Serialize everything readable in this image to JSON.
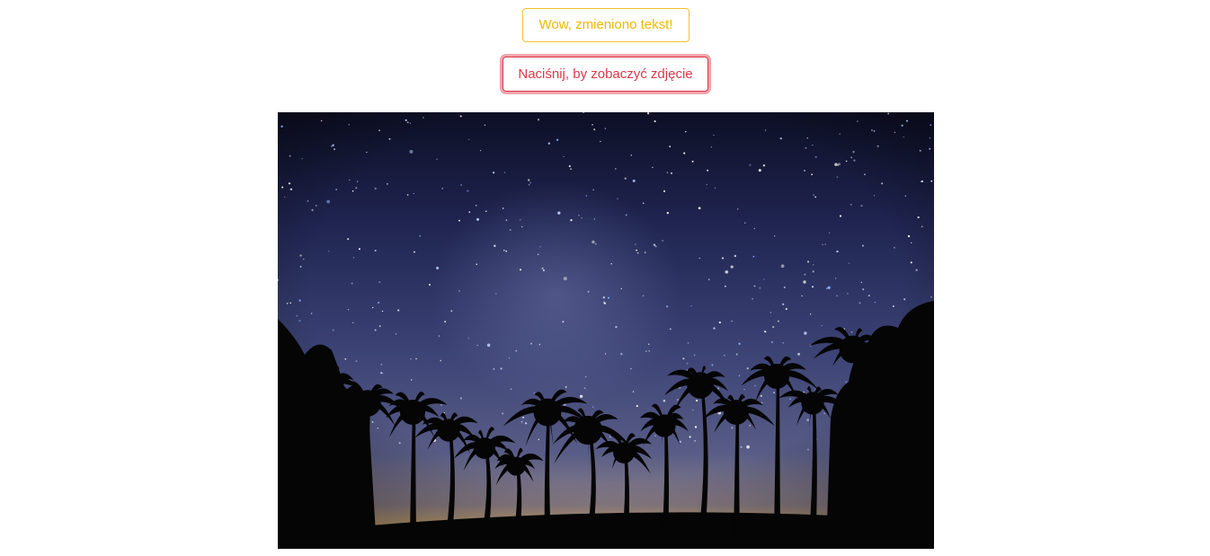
{
  "buttons": {
    "changed_text_label": "Wow, zmieniono tekst!",
    "show_photo_label": "Naciśnij, by zobaczyć zdjęcie"
  },
  "photo": {
    "icon": "night-sky-palm-trees-photo",
    "colors": {
      "sky_top": "#0e1028",
      "sky_mid": "#3a4070",
      "sky_low": "#5a5f8a",
      "horizon_glow": "#e2b874",
      "silhouette": "#050505"
    }
  },
  "colors": {
    "warning": "#f0b800",
    "danger": "#dc3545"
  }
}
